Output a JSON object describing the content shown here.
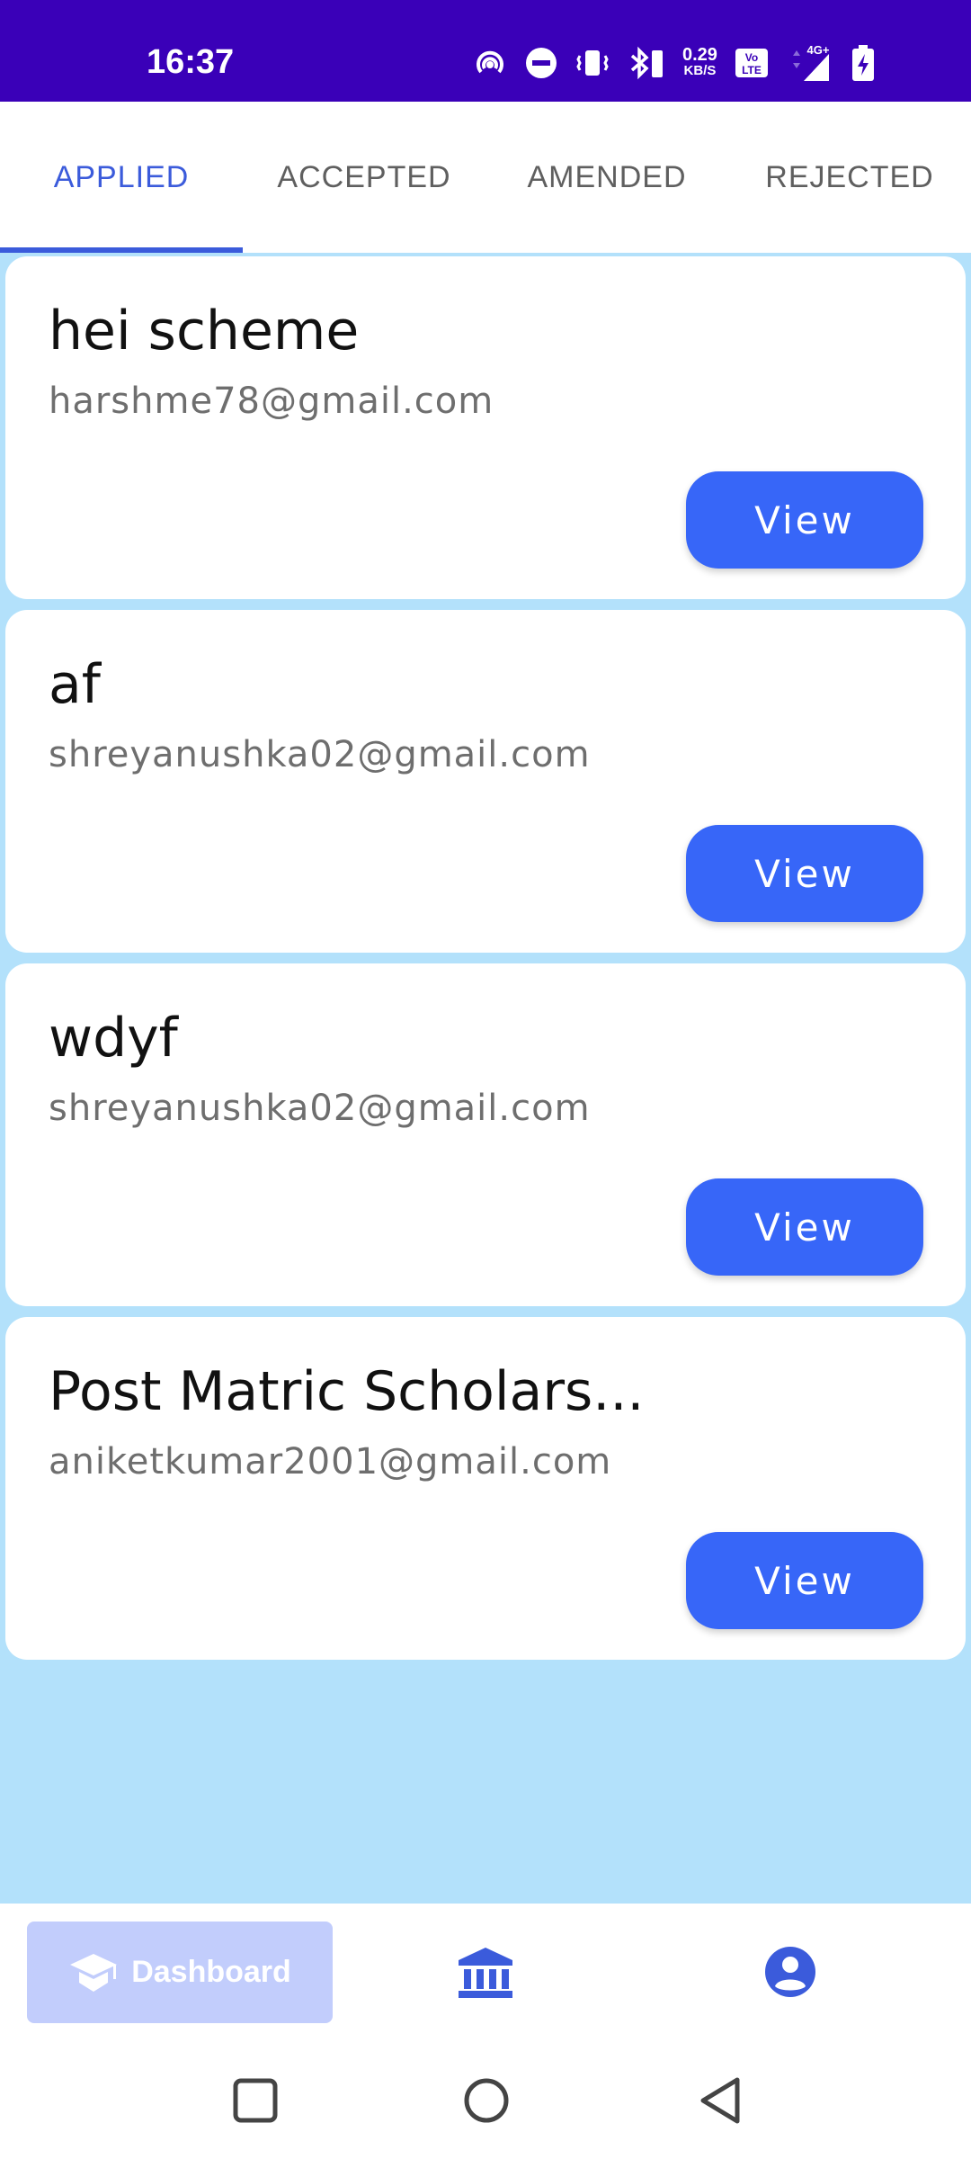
{
  "status_bar": {
    "time": "16:37",
    "net_speed_value": "0.29",
    "net_speed_unit": "KB/S",
    "network": "4G+",
    "background_color": "#3a00b8"
  },
  "tabs": [
    {
      "label": "APPLIED",
      "active": true
    },
    {
      "label": "ACCEPTED",
      "active": false
    },
    {
      "label": "AMENDED",
      "active": false
    },
    {
      "label": "REJECTED",
      "active": false
    }
  ],
  "cards": [
    {
      "title": "hei scheme",
      "email": "harshme78@gmail.com",
      "button": "View"
    },
    {
      "title": "af",
      "email": "shreyanushka02@gmail.com",
      "button": "View"
    },
    {
      "title": "wdyf",
      "email": "shreyanushka02@gmail.com",
      "button": "View"
    },
    {
      "title": "Post Matric Scholars...",
      "email": "aniketkumar2001@gmail.com",
      "button": "View"
    }
  ],
  "bottom_nav": {
    "dashboard_label": "Dashboard",
    "items": [
      "dashboard-icon",
      "institution-icon",
      "profile-icon"
    ]
  },
  "colors": {
    "accent": "#3b5bdb",
    "button": "#3766f8",
    "content_background": "#b3e1fb",
    "dashboard_pill": "#c2cdfc"
  }
}
